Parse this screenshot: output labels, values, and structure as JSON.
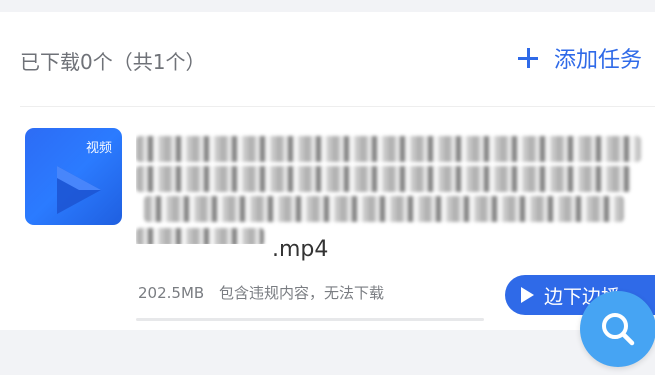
{
  "header": {
    "download_count": "已下载0个（共1个）",
    "add_task_label": "添加任务"
  },
  "file": {
    "thumbnail_label": "视频",
    "extension": ".mp4",
    "size": "202.5MB",
    "status_message": "包含违规内容，无法下载",
    "progress_fraction": 0,
    "play_button_label": "边下边播"
  },
  "icons": {
    "add": "plus-icon",
    "thumbnail": "video-play-icon",
    "play": "play-icon",
    "fab": "search-icon"
  },
  "colors": {
    "accent": "#2f6ae8",
    "fab": "#46a4f3",
    "thumbnail": "#2d6cf5"
  }
}
